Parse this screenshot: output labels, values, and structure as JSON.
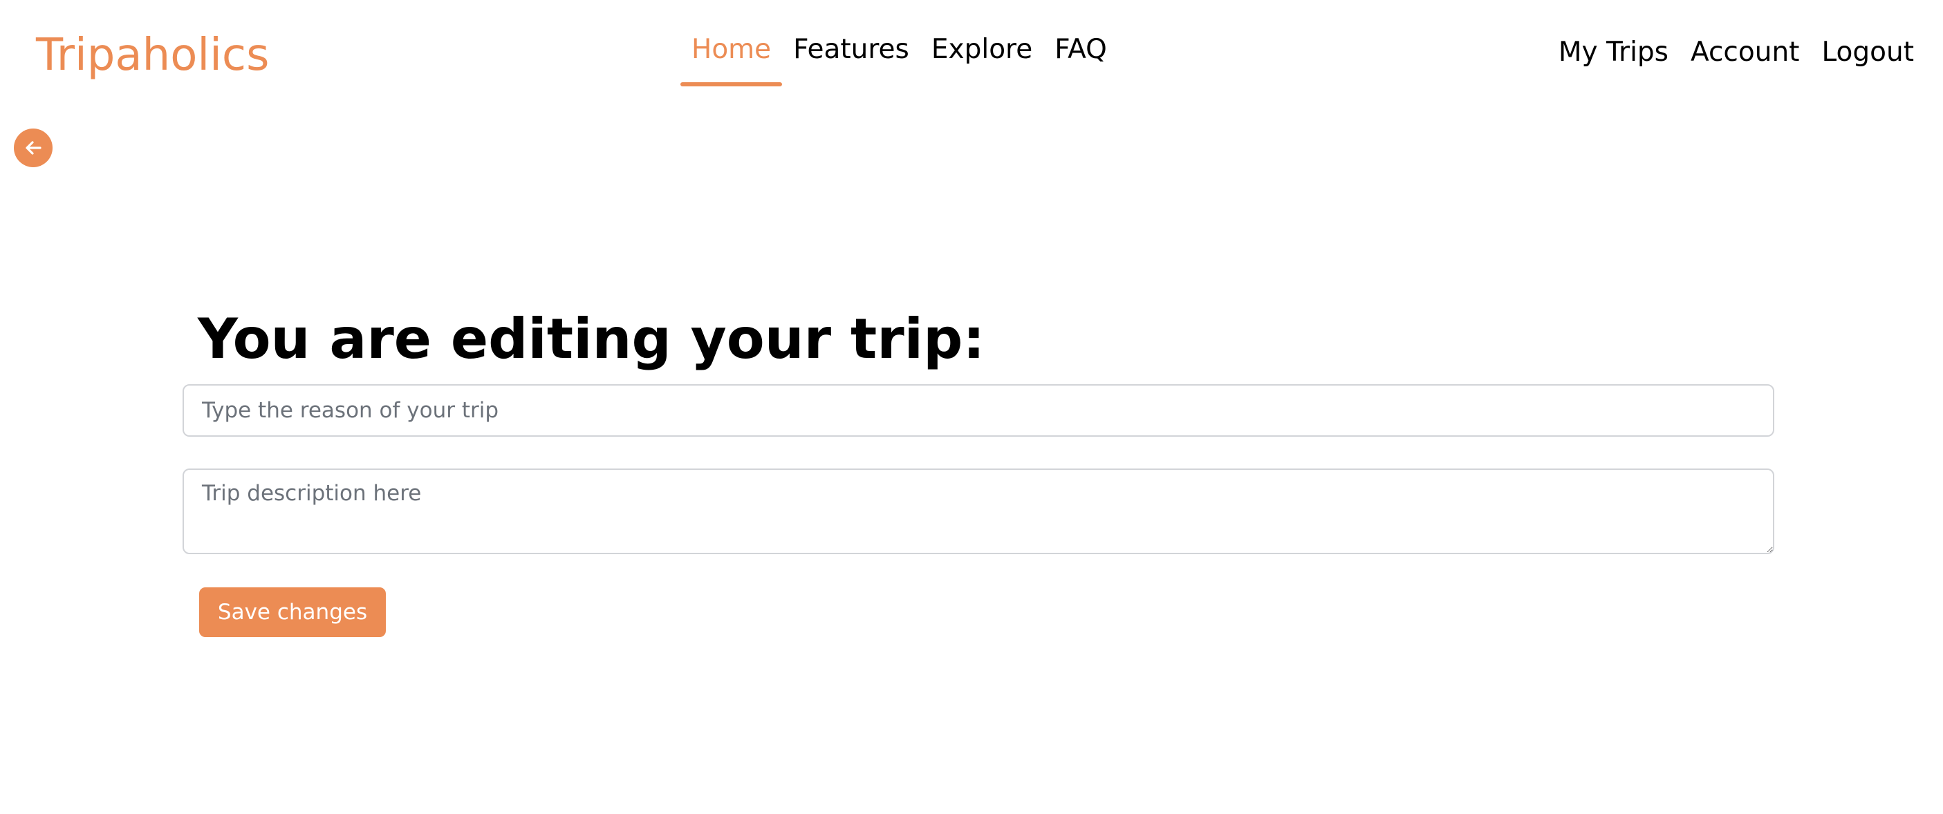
{
  "brand": {
    "name": "Tripaholics",
    "accent_color": "#ec8c54"
  },
  "nav": {
    "center": [
      {
        "label": "Home",
        "active": true
      },
      {
        "label": "Features",
        "active": false
      },
      {
        "label": "Explore",
        "active": false
      },
      {
        "label": "FAQ",
        "active": false
      }
    ],
    "right": [
      {
        "label": "My Trips"
      },
      {
        "label": "Account"
      },
      {
        "label": "Logout"
      }
    ]
  },
  "back_button": {
    "icon": "arrow-left-icon"
  },
  "form": {
    "title": "You are editing your trip:",
    "reason_input": {
      "placeholder": "Type the reason of your trip",
      "value": ""
    },
    "description_textarea": {
      "placeholder": "Trip description here",
      "value": ""
    },
    "save_label": "Save changes"
  }
}
